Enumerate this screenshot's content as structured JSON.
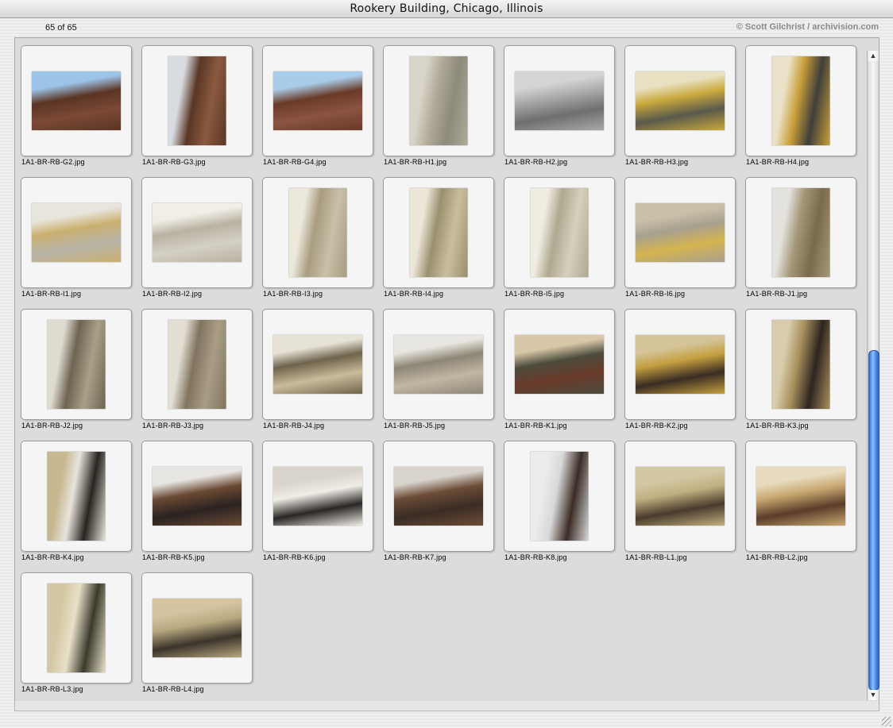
{
  "window": {
    "title": "Rookery Building, Chicago, Illinois"
  },
  "header": {
    "count": "65 of 65",
    "copyright": "© Scott Gilchrist / archivision.com"
  },
  "thumbnails": [
    {
      "file": "1A1-BR-RB-G2.jpg",
      "orient": "landscape",
      "colors": [
        "#9cc4e8",
        "#7a4a36",
        "#5b3424"
      ]
    },
    {
      "file": "1A1-BR-RB-G3.jpg",
      "orient": "portrait",
      "colors": [
        "#d8dce0",
        "#8a5a40",
        "#5a3624"
      ]
    },
    {
      "file": "1A1-BR-RB-G4.jpg",
      "orient": "landscape",
      "colors": [
        "#a9cde8",
        "#8a5440",
        "#6a3a28"
      ]
    },
    {
      "file": "1A1-BR-RB-H1.jpg",
      "orient": "portrait",
      "colors": [
        "#d8d4c8",
        "#8d8a7c",
        "#b0aa98"
      ]
    },
    {
      "file": "1A1-BR-RB-H2.jpg",
      "orient": "landscape",
      "colors": [
        "#d4d4d4",
        "#6e6e6e",
        "#a8a8a8"
      ]
    },
    {
      "file": "1A1-BR-RB-H3.jpg",
      "orient": "landscape",
      "colors": [
        "#e8e0c0",
        "#5a5a4c",
        "#c9a83c"
      ]
    },
    {
      "file": "1A1-BR-RB-H4.jpg",
      "orient": "portrait",
      "colors": [
        "#eae2c8",
        "#3e3e3a",
        "#c9a03a"
      ]
    },
    {
      "file": "1A1-BR-RB-I1.jpg",
      "orient": "landscape",
      "colors": [
        "#e8e6dc",
        "#b8b4a8",
        "#c9b070"
      ]
    },
    {
      "file": "1A1-BR-RB-I2.jpg",
      "orient": "landscape",
      "colors": [
        "#f0eee6",
        "#d4d0c4",
        "#b8b2a2"
      ]
    },
    {
      "file": "1A1-BR-RB-I3.jpg",
      "orient": "portrait",
      "colors": [
        "#ece8dc",
        "#c8c0a8",
        "#a89c80"
      ]
    },
    {
      "file": "1A1-BR-RB-I4.jpg",
      "orient": "portrait",
      "colors": [
        "#ebe6d6",
        "#c9bf9e",
        "#9a9070"
      ]
    },
    {
      "file": "1A1-BR-RB-I5.jpg",
      "orient": "portrait",
      "colors": [
        "#efece2",
        "#d6d0bc",
        "#b0a890"
      ]
    },
    {
      "file": "1A1-BR-RB-I6.jpg",
      "orient": "landscape",
      "colors": [
        "#c9c0a8",
        "#d4b450",
        "#a8a090"
      ]
    },
    {
      "file": "1A1-BR-RB-J1.jpg",
      "orient": "portrait",
      "colors": [
        "#e4e2dc",
        "#7a6a4c",
        "#a49878"
      ]
    },
    {
      "file": "1A1-BR-RB-J2.jpg",
      "orient": "portrait",
      "colors": [
        "#dedbd0",
        "#a8a088",
        "#6e6452"
      ]
    },
    {
      "file": "1A1-BR-RB-J3.jpg",
      "orient": "portrait",
      "colors": [
        "#e2ded2",
        "#a89e84",
        "#807460"
      ]
    },
    {
      "file": "1A1-BR-RB-J4.jpg",
      "orient": "landscape",
      "colors": [
        "#e6e2d6",
        "#c8bd9a",
        "#6e644c"
      ]
    },
    {
      "file": "1A1-BR-RB-J5.jpg",
      "orient": "landscape",
      "colors": [
        "#e8e6e0",
        "#c0b8a4",
        "#8e8674"
      ]
    },
    {
      "file": "1A1-BR-RB-K1.jpg",
      "orient": "landscape",
      "colors": [
        "#d8c8a8",
        "#6a3a2a",
        "#4c4c3c"
      ]
    },
    {
      "file": "1A1-BR-RB-K2.jpg",
      "orient": "landscape",
      "colors": [
        "#d4c498",
        "#3a2c22",
        "#c4a040"
      ]
    },
    {
      "file": "1A1-BR-RB-K3.jpg",
      "orient": "portrait",
      "colors": [
        "#d8ccac",
        "#2e2420",
        "#a8905c"
      ]
    },
    {
      "file": "1A1-BR-RB-K4.jpg",
      "orient": "portrait",
      "colors": [
        "#c8b890",
        "#2a2420",
        "#e8e4dc"
      ]
    },
    {
      "file": "1A1-BR-RB-K5.jpg",
      "orient": "landscape",
      "colors": [
        "#e8e6e2",
        "#2a2220",
        "#6a4a34"
      ]
    },
    {
      "file": "1A1-BR-RB-K6.jpg",
      "orient": "landscape",
      "colors": [
        "#d8d4cc",
        "#2a2624",
        "#f0ece6"
      ]
    },
    {
      "file": "1A1-BR-RB-K7.jpg",
      "orient": "landscape",
      "colors": [
        "#d8d4cc",
        "#3a2c24",
        "#6c4c36"
      ]
    },
    {
      "file": "1A1-BR-RB-K8.jpg",
      "orient": "portrait",
      "colors": [
        "#ececec",
        "#3a2c24",
        "#d8d8d8"
      ]
    },
    {
      "file": "1A1-BR-RB-L1.jpg",
      "orient": "landscape",
      "colors": [
        "#d4c8a4",
        "#4a3a2c",
        "#c0b080"
      ]
    },
    {
      "file": "1A1-BR-RB-L2.jpg",
      "orient": "landscape",
      "colors": [
        "#e8dcc0",
        "#5a3c2a",
        "#c8a870"
      ]
    },
    {
      "file": "1A1-BR-RB-L3.jpg",
      "orient": "portrait",
      "colors": [
        "#d4c8a4",
        "#3a3a2c",
        "#e8e0c8"
      ]
    },
    {
      "file": "1A1-BR-RB-L4.jpg",
      "orient": "landscape",
      "colors": [
        "#d4c4a0",
        "#3a342a",
        "#b8a880"
      ]
    }
  ]
}
